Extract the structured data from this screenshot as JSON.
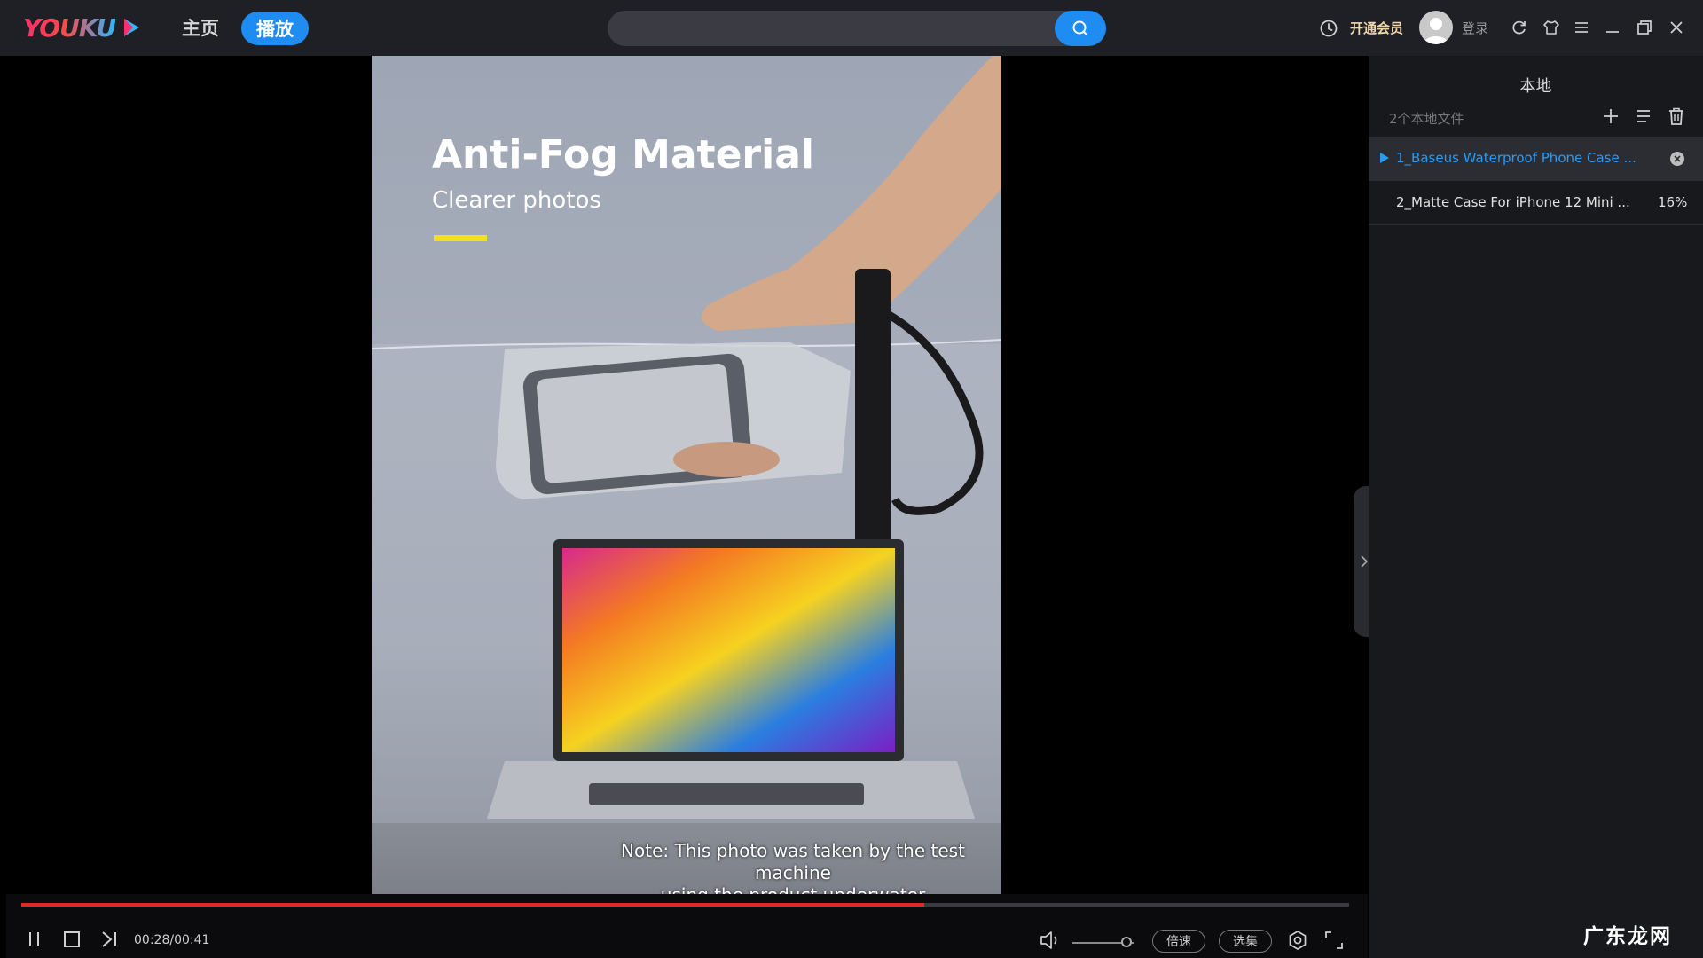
{
  "header": {
    "logo_text": "YOUKU",
    "nav_home": "主页",
    "nav_play": "播放",
    "search_placeholder": "",
    "vip_label": "开通会员",
    "login_label": "登录"
  },
  "video": {
    "title": "Anti-Fog Material",
    "subtitle": "Clearer photos",
    "caption_line1": "Note: This photo was taken by the test machine",
    "caption_line2": "using the product underwater"
  },
  "controls": {
    "time": "00:28/00:41",
    "progress": 0.68,
    "volume": 0.78,
    "speed_label": "倍速",
    "episodes_label": "选集"
  },
  "sidebar": {
    "title": "本地",
    "file_count": "2个本地文件",
    "items": [
      {
        "name": "1_Baseus Waterproof Phone Case ...",
        "active": true
      },
      {
        "name": "2_Matte Case For iPhone 12 Mini ...",
        "progress": "16%"
      }
    ]
  },
  "watermark": "广东龙网",
  "colors": {
    "accent": "#1e8cf0",
    "progress": "#e02a2a",
    "active_item_text": "#2b9af3",
    "topbar_bg": "#1f2026",
    "sidebar_bg": "#18191d"
  }
}
